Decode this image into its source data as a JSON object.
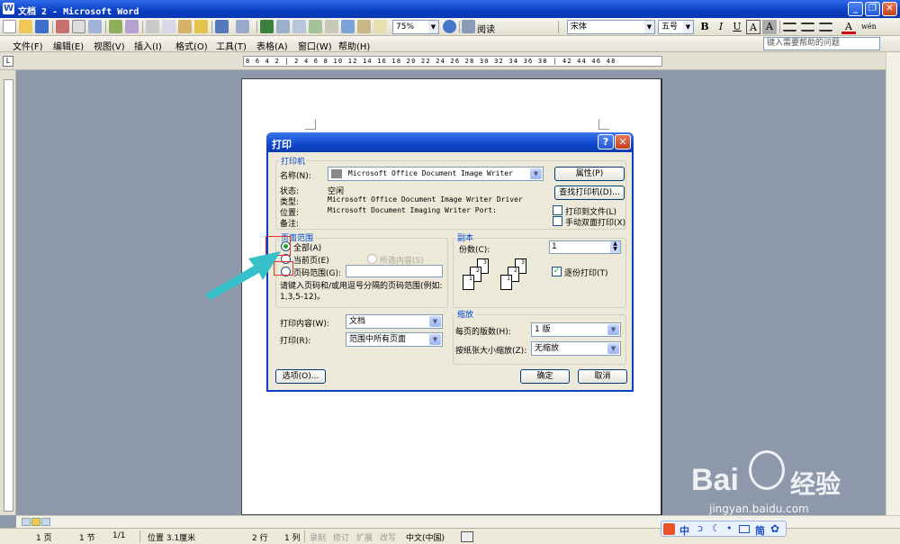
{
  "window": {
    "title": "文档 2 - Microsoft Word"
  },
  "toolbar": {
    "zoom": "75%",
    "reading_label": "阅读",
    "font_name": "宋体",
    "font_size": "五号",
    "bold": "B",
    "italic": "I",
    "underline": "U",
    "char_border": "A",
    "char_shade": "A",
    "font_color_letter": "A",
    "phonetic": "wén"
  },
  "menu": {
    "items": [
      "文件(F)",
      "编辑(E)",
      "视图(V)",
      "插入(I)",
      "格式(O)",
      "工具(T)",
      "表格(A)",
      "窗口(W)",
      "帮助(H)"
    ],
    "help_placeholder": "键入需要帮助的问题"
  },
  "ruler": {
    "corner": "L",
    "ticks": "8 6 4 2 | 2 4 6 8 10 12 14 16 18 20 22 24 26 28 30 32 34 36 38 | 42 44 46 48"
  },
  "dialog": {
    "title": "打印",
    "help_btn": "?",
    "close_btn": "✕",
    "printer": {
      "group_label": "打印机",
      "name_label": "名称(N):",
      "name_value": "Microsoft Office Document Image Writer",
      "status_label": "状态:",
      "status_value": "空闲",
      "type_label": "类型:",
      "type_value": "Microsoft Office Document Image Writer Driver",
      "where_label": "位置:",
      "where_value": "Microsoft Document Imaging Writer Port:",
      "comment_label": "备注:",
      "properties_btn": "属性(P)",
      "find_btn": "查找打印机(D)...",
      "print_to_file": "打印到文件(L)",
      "manual_duplex": "手动双面打印(X)"
    },
    "page_range": {
      "group_label": "页面范围",
      "all": "全部(A)",
      "current": "当前页(E)",
      "selection": "所选内容(S)",
      "pages": "页码范围(G):",
      "hint": "请键入页码和/或用逗号分隔的页码范围(例如: 1,3,5-12)。"
    },
    "copies": {
      "group_label": "副本",
      "count_label": "份数(C):",
      "count_value": "1",
      "collate": "逐份打印(T)",
      "collate_checked": true
    },
    "print_what_label": "打印内容(W):",
    "print_what_value": "文档",
    "print_label": "打印(R):",
    "print_value": "范围中所有页面",
    "zoom": {
      "group_label": "缩放",
      "pages_per_sheet_label": "每页的版数(H):",
      "pages_per_sheet_value": "1 版",
      "scale_label": "按纸张大小缩放(Z):",
      "scale_value": "无缩放"
    },
    "options_btn": "选项(O)...",
    "ok_btn": "确定",
    "cancel_btn": "取消"
  },
  "status": {
    "page": "1 页",
    "section": "1 节",
    "page_of": "1/1",
    "position": "位置 3.1厘米",
    "line": "2 行",
    "column": "1 列",
    "rec": "录制",
    "trk": "修订",
    "ext": "扩展",
    "ovr": "改写",
    "language": "中文(中国)"
  },
  "watermark": {
    "brand": "Bai",
    "brand2": "经验",
    "url": "jingyan.baidu.com"
  },
  "ime": {
    "mode": "中",
    "simp": "简"
  },
  "colors": {
    "title_blue": "#0a3fc4",
    "workspace": "#8d99ab",
    "arrow_teal": "#36c0c8",
    "highlight_red": "#e03030"
  }
}
